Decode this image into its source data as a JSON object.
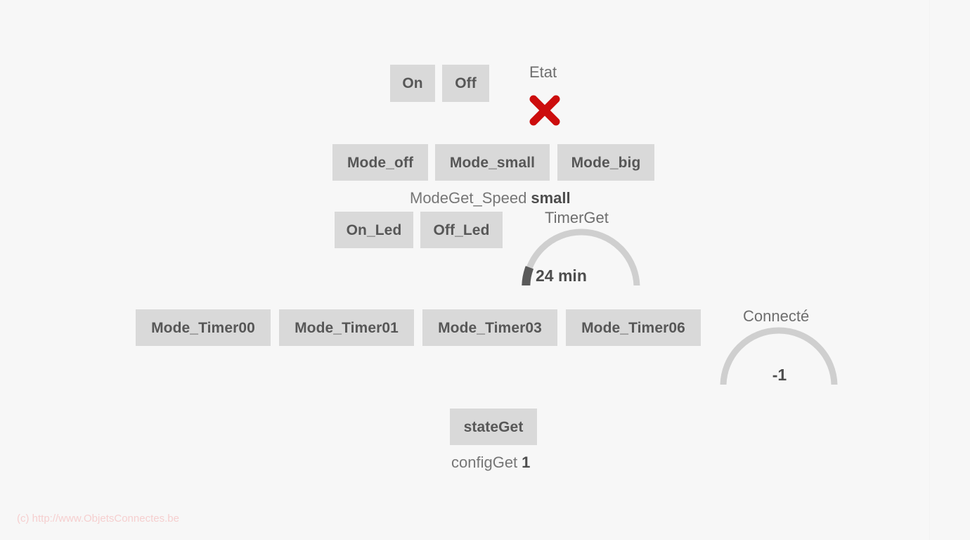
{
  "page": {
    "background_color": "#f7f7f7",
    "button_color": "#d9d9d9",
    "button_text_color": "#575757",
    "label_color": "#6e6e6e",
    "accent_red": "#cc0d0d",
    "gauge_track_color": "#cfcfcf",
    "gauge_fill_color": "#5a5a5a"
  },
  "power_row": {
    "on_label": "On",
    "off_label": "Off"
  },
  "etat": {
    "title": "Etat",
    "status_icon": "cross-mark",
    "status_color": "#cc0d0d"
  },
  "mode_row": {
    "mode_off_label": "Mode_off",
    "mode_small_label": "Mode_small",
    "mode_big_label": "Mode_big"
  },
  "mode_get_speed": {
    "name": "ModeGet_Speed",
    "value": "small"
  },
  "led_row": {
    "on_led_label": "On_Led",
    "off_led_label": "Off_Led"
  },
  "timer_gauge": {
    "title": "TimerGet",
    "value_text": "24 min",
    "value": 24,
    "min": 0,
    "max": 60,
    "unit": "min"
  },
  "timer_mode_row": {
    "buttons": [
      {
        "label": "Mode_Timer00"
      },
      {
        "label": "Mode_Timer01"
      },
      {
        "label": "Mode_Timer03"
      },
      {
        "label": "Mode_Timer06"
      }
    ]
  },
  "connect_gauge": {
    "title": "Connecté",
    "value_text": "-1",
    "value": -1
  },
  "state_section": {
    "state_get_label": "stateGet",
    "config_get_name": "configGet",
    "config_get_value": "1"
  },
  "footer": {
    "text": "(c) http://www.ObjetsConnectes.be"
  }
}
